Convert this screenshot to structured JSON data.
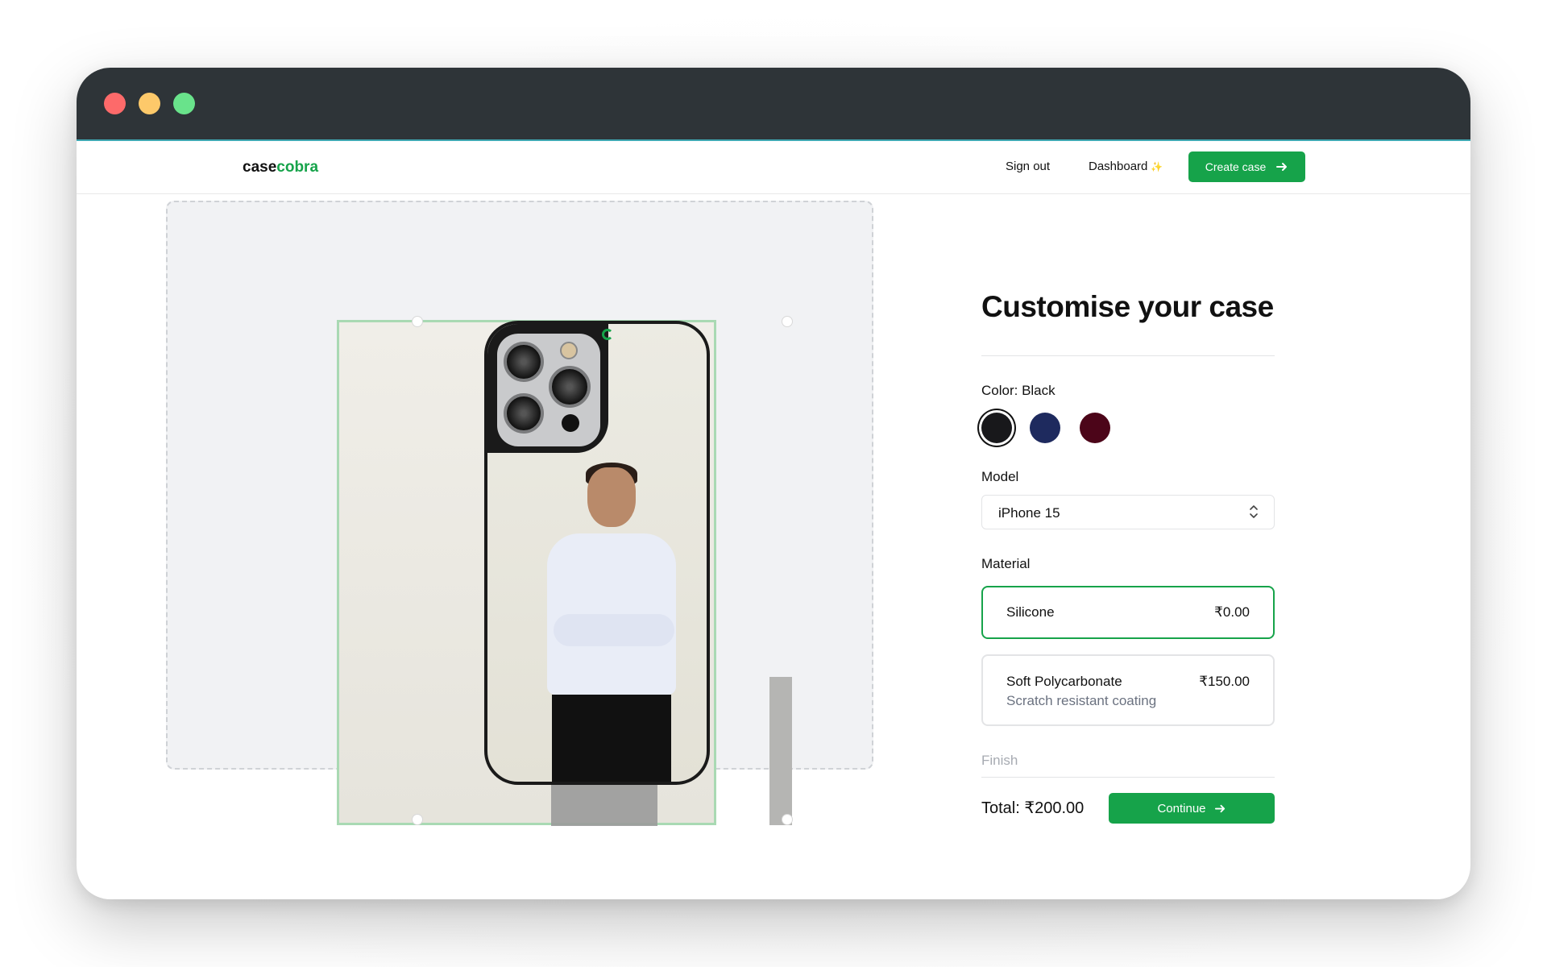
{
  "app": {
    "logo_part1": "case",
    "logo_part2": "cobra"
  },
  "nav": {
    "sign_out": "Sign out",
    "dashboard": "Dashboard",
    "dashboard_sparkle": "✨",
    "create_case": "Create case",
    "create_case_icon": "arrow-right-icon"
  },
  "panel": {
    "title": "Customise your case",
    "color_label": "Color: Black",
    "colors": [
      {
        "name": "Black",
        "hex": "#18181b",
        "selected": true
      },
      {
        "name": "Blue",
        "hex": "#1e2a5e",
        "selected": false
      },
      {
        "name": "Rose",
        "hex": "#4c0519",
        "selected": false
      }
    ],
    "model_label": "Model",
    "model_value": "iPhone 15",
    "material_label": "Material",
    "materials": [
      {
        "name": "Silicone",
        "price": "₹0.00",
        "desc": ""
      },
      {
        "name": "Soft Polycarbonate",
        "price": "₹150.00",
        "desc": "Scratch resistant coating"
      }
    ],
    "finish_label": "Finish",
    "total": "Total: ₹200.00",
    "continue": "Continue",
    "continue_icon": "arrow-right-icon"
  },
  "theme": {
    "accent": "#16a34a",
    "titlebar": "#2e3438"
  }
}
